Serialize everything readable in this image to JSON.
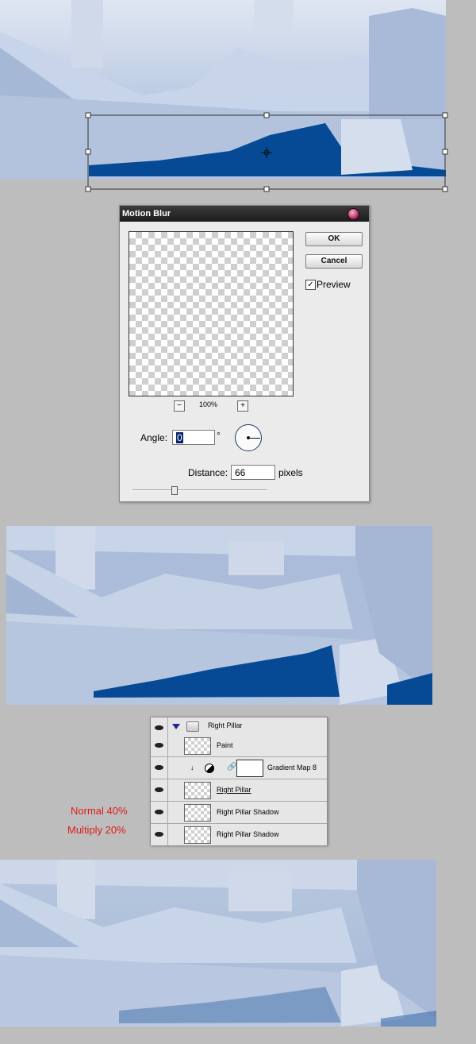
{
  "dialog": {
    "title": "Motion Blur",
    "ok_label": "OK",
    "cancel_label": "Cancel",
    "preview_label": "Preview",
    "preview_checked": true,
    "check_mark": "✓",
    "zoom_out": "−",
    "zoom_in": "+",
    "zoom_level": "100%",
    "angle_label": "Angle:",
    "angle_value": "0",
    "degree_symbol": "°",
    "distance_label": "Distance:",
    "distance_value": "66",
    "distance_unit": "pixels"
  },
  "layers": [
    {
      "name": "Right Pillar",
      "type": "group"
    },
    {
      "name": "Paint",
      "type": "layer"
    },
    {
      "name": "Gradient Map 8",
      "type": "adjustment"
    },
    {
      "name": "Right Pillar",
      "type": "layer"
    },
    {
      "name": "Right Pillar Shadow",
      "type": "layer"
    },
    {
      "name": "Right Pillar Shadow",
      "type": "layer"
    }
  ],
  "notes": {
    "normal": "Normal 40%",
    "multiply": "Multiply 20%"
  },
  "colors": {
    "shadow_blue": "#064a96",
    "sky": "#a8bbd7",
    "accent_red": "#e01b1b"
  }
}
